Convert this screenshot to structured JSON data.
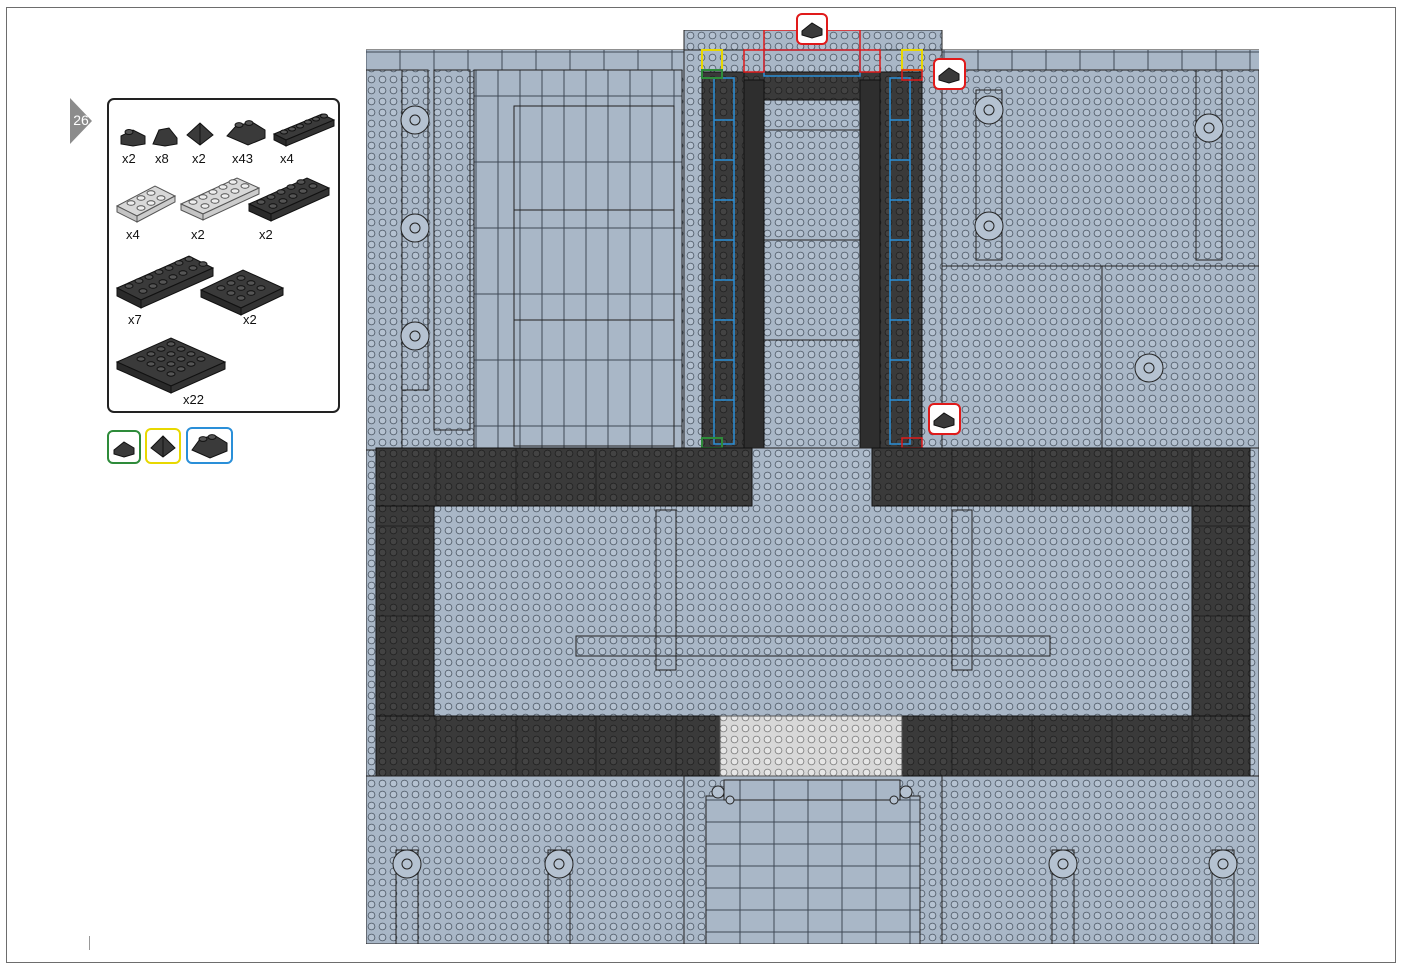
{
  "step": {
    "number": "26"
  },
  "parts_list": [
    {
      "id": "slope-1x1",
      "icon": "dark-1x1-slope-icon",
      "count": "x2"
    },
    {
      "id": "cheese-slope",
      "icon": "dark-cheese-slope-icon",
      "count": "x8"
    },
    {
      "id": "pyramid-slope",
      "icon": "dark-pyramid-slope-icon",
      "count": "x2"
    },
    {
      "id": "wedge-2x2",
      "icon": "dark-2x2-wedge-icon",
      "count": "x43"
    },
    {
      "id": "plate-1x6",
      "icon": "dark-1x6-plate-icon",
      "count": "x4"
    },
    {
      "id": "light-plate-2x4",
      "icon": "light-2x4-plate-icon",
      "count": "x4"
    },
    {
      "id": "light-plate-2x6",
      "icon": "light-2x6-plate-icon",
      "count": "x2"
    },
    {
      "id": "dark-plate-2x6",
      "icon": "dark-2x6-plate-icon",
      "count": "x2"
    },
    {
      "id": "dark-plate-2x8",
      "icon": "dark-2x8-plate-icon",
      "count": "x7"
    },
    {
      "id": "dark-plate-4x4",
      "icon": "dark-4x4-plate-icon",
      "count": "x2"
    },
    {
      "id": "dark-plate-6x6",
      "icon": "dark-6x6-plate-icon",
      "count": "x22"
    }
  ],
  "legend": [
    {
      "id": "green",
      "icon": "slope-key-icon",
      "color": "#2e8b3a"
    },
    {
      "id": "yellow",
      "icon": "pyramid-key-icon",
      "color": "#e8d800"
    },
    {
      "id": "blue",
      "icon": "wedge-key-icon",
      "color": "#2a8fd8"
    }
  ],
  "colors": {
    "baseplate": "#a9b7c7",
    "baseplate_line": "#4a5562",
    "dark_plate": "#3a3a3a",
    "light_plate": "#d8d8d8",
    "callout_red": "#e01a1a"
  }
}
